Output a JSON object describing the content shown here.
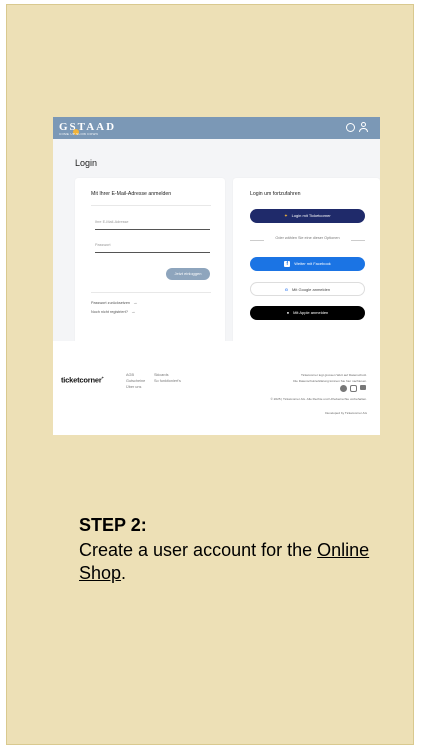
{
  "header": {
    "logo": "GSTAAD",
    "logo_sub": "COME UP SLOW DOWN"
  },
  "page": {
    "title": "Login"
  },
  "email_login": {
    "title": "Mit Ihrer E-Mail-Adresse anmelden",
    "email_placeholder": "Ihre E-Mail-Adresse",
    "password_placeholder": "Passwort",
    "login_button": "Jetzt einloggen",
    "reset_link": "Passwort zurücksetzen",
    "register_link": "Noch nicht registriert?"
  },
  "social_login": {
    "title": "Login um fortzufahren",
    "ticketcorner_button": "Login mit Ticketcorner",
    "or_text": "Oder wählen Sie eine dieser Optionen",
    "facebook_button": "Weiter mit Facebook",
    "google_button": "Mit Google anmelden",
    "apple_button": "Mit Apple anmelden"
  },
  "footer": {
    "logo": "ticketcorner",
    "col1": [
      "AGB",
      "Gutscheine",
      "Über uns"
    ],
    "col2": [
      "Skicards",
      "So funktioniert's"
    ],
    "privacy_line1": "Ticketcorner legt grossen Wert auf Datenschutz.",
    "privacy_line2": "Die Datenschutzerklärung können Sie hier nachlesen.",
    "copyright": "© 2025 | Ticketcorner AG. Alle Rechte und Urheberrechte vorbehalten.",
    "developed_by": "Developed by Ticketcorner AG"
  },
  "caption": {
    "title": "STEP 2:",
    "text": "Create a user account for the ",
    "link": "Online Shop",
    "text_end": "."
  },
  "colors": {
    "card": "#ede0b6",
    "header": "#7b98b6",
    "ticketcorner": "#1f2a6a",
    "facebook": "#1b74e4"
  }
}
